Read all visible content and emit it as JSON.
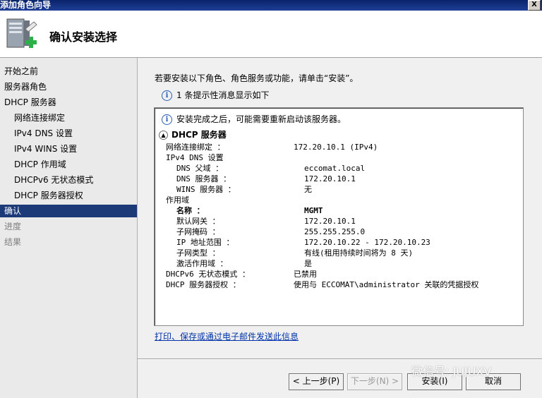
{
  "window": {
    "title": "添加角色向导",
    "close_label": "X"
  },
  "header": {
    "title": "确认安装选择"
  },
  "sidebar": {
    "items": [
      {
        "label": "开始之前"
      },
      {
        "label": "服务器角色"
      },
      {
        "label": "DHCP 服务器"
      },
      {
        "label": "网络连接绑定"
      },
      {
        "label": "IPv4 DNS 设置"
      },
      {
        "label": "IPv4 WINS 设置"
      },
      {
        "label": "DHCP 作用域"
      },
      {
        "label": "DHCPv6 无状态模式"
      },
      {
        "label": "DHCP 服务器授权"
      },
      {
        "label": "确认"
      },
      {
        "label": "进度"
      },
      {
        "label": "结果"
      }
    ]
  },
  "main": {
    "intro": "若要安装以下角色、角色服务或功能，请单击“安装”。",
    "info_count": "1 条提示性消息显示如下",
    "box": {
      "note": "安装完成之后，可能需要重新启动该服务器。",
      "section": "DHCP 服务器",
      "rows": [
        {
          "label": "网络连接绑定 ：",
          "value": "172.20.10.1 (IPv4)"
        },
        {
          "label": "IPv4 DNS 设置",
          "value": ""
        },
        {
          "label": "DNS 父域 ：",
          "value": "eccomat.local"
        },
        {
          "label": "DNS 服务器 ：",
          "value": "172.20.10.1"
        },
        {
          "label": "WINS 服务器 ：",
          "value": "无"
        },
        {
          "label": "作用域",
          "value": ""
        },
        {
          "label": "名称 ：",
          "value": "MGMT"
        },
        {
          "label": "默认网关 ：",
          "value": "172.20.10.1"
        },
        {
          "label": "子网掩码 ：",
          "value": "255.255.255.0"
        },
        {
          "label": "IP 地址范围 ：",
          "value": "172.20.10.22 - 172.20.10.23"
        },
        {
          "label": "子网类型 ：",
          "value": "有线(租用持续时间将为 8 天)"
        },
        {
          "label": "激活作用域 ：",
          "value": "是"
        },
        {
          "label": "DHCPv6 无状态模式 ：",
          "value": "已禁用"
        },
        {
          "label": "DHCP 服务器授权 ：",
          "value": "使用与 ECCOMAT\\administrator 关联的凭据授权"
        }
      ]
    },
    "link": "打印、保存或通过电子邮件发送此信息"
  },
  "buttons": {
    "prev": "< 上一步(P)",
    "next": "下一步(N) >",
    "install": "安装(I)",
    "cancel": "取消"
  },
  "watermark": "微信号: JUJUXV"
}
